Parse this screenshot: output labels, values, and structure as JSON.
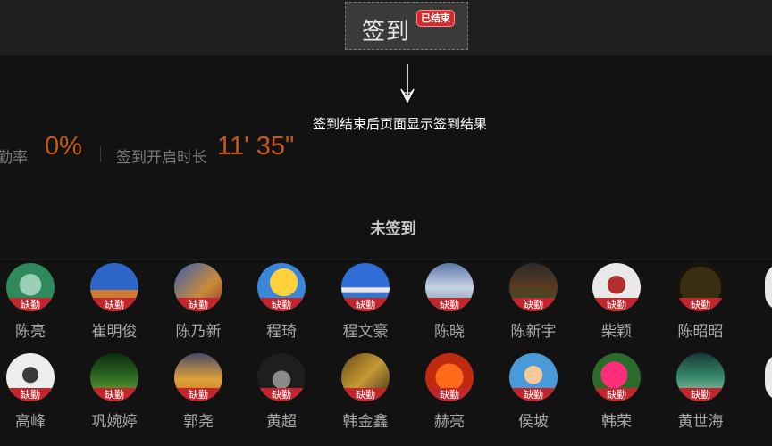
{
  "header": {
    "title": "签到",
    "status_badge": "已结束"
  },
  "annotation": "签到结束后页面显示签到结果",
  "stats": {
    "attendance_label": "出勤率",
    "attendance_value": "0%",
    "duration_label": "签到开启时长",
    "duration_value": "11' 35\""
  },
  "section_title": "未签到",
  "absent_label": "缺勤",
  "colors": {
    "accent": "#c65a12",
    "badge": "#d22a2a",
    "band": "#c2262c"
  },
  "people": [
    {
      "name": "陈亮"
    },
    {
      "name": "崔明俊"
    },
    {
      "name": "陈乃新"
    },
    {
      "name": "程琦"
    },
    {
      "name": "程文豪"
    },
    {
      "name": "陈晓"
    },
    {
      "name": "陈新宇"
    },
    {
      "name": "柴颖"
    },
    {
      "name": "陈昭昭"
    },
    {
      "name": "高峰"
    },
    {
      "name": "巩婉婷"
    },
    {
      "name": "郭尧"
    },
    {
      "name": "黄超"
    },
    {
      "name": "韩金鑫"
    },
    {
      "name": "赫亮"
    },
    {
      "name": "侯坡"
    },
    {
      "name": "韩荣"
    },
    {
      "name": "黄世海"
    }
  ]
}
